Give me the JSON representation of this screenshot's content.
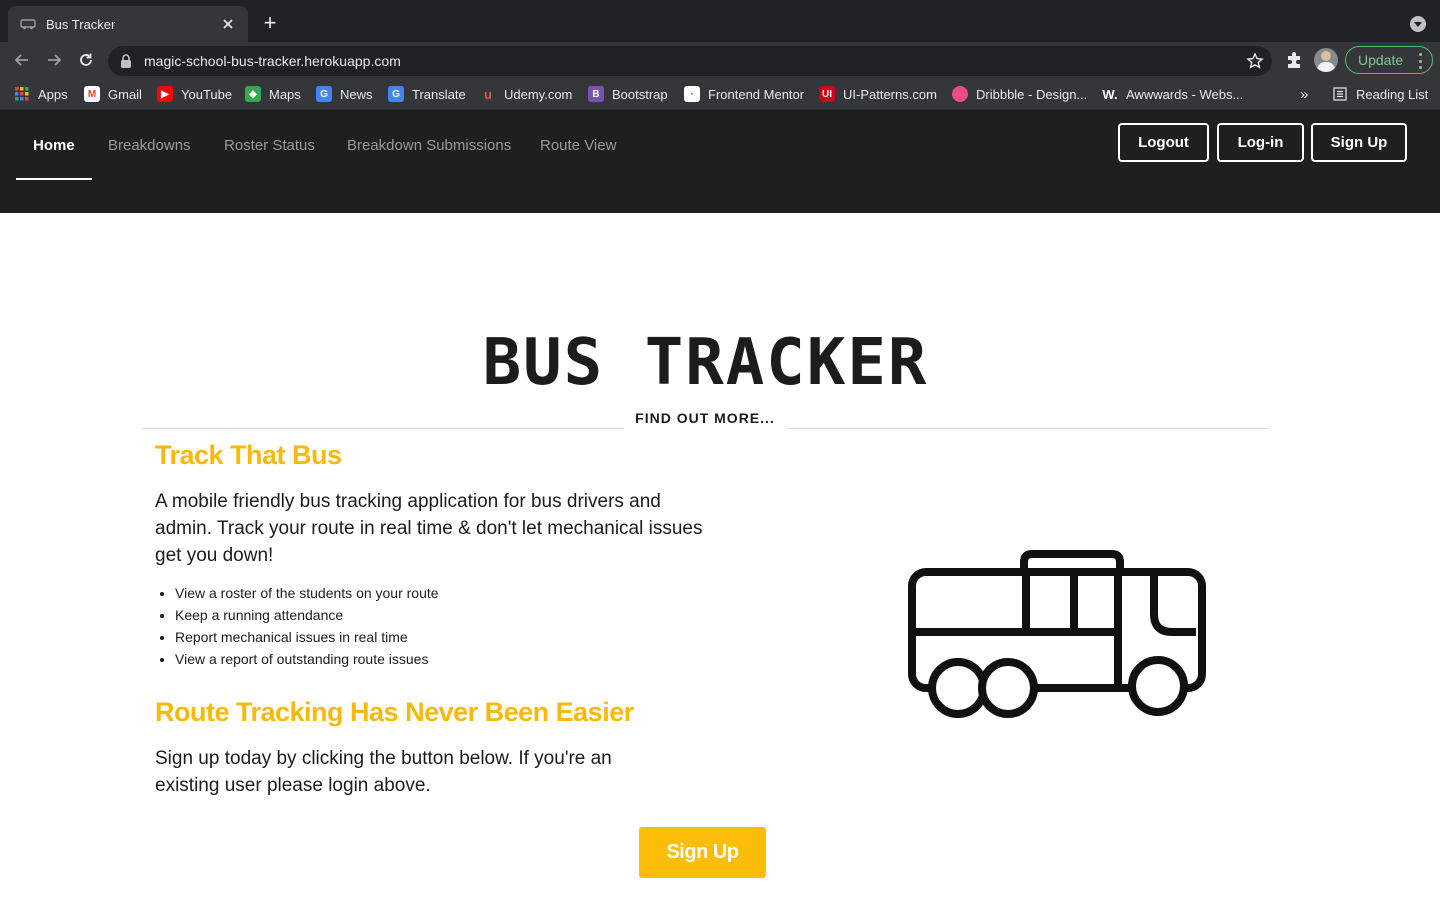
{
  "browser": {
    "tab_title": "Bus Tracker",
    "url": "magic-school-bus-tracker.herokuapp.com",
    "update_label": "Update",
    "bookmarks": [
      {
        "label": "Apps",
        "icon": "apps-grid-icon"
      },
      {
        "label": "Gmail",
        "icon": "gmail-icon"
      },
      {
        "label": "YouTube",
        "icon": "youtube-icon"
      },
      {
        "label": "Maps",
        "icon": "maps-icon"
      },
      {
        "label": "News",
        "icon": "news-icon"
      },
      {
        "label": "Translate",
        "icon": "translate-icon"
      },
      {
        "label": "Udemy.com",
        "icon": "udemy-icon"
      },
      {
        "label": "Bootstrap",
        "icon": "bootstrap-icon"
      },
      {
        "label": "Frontend Mentor",
        "icon": "frontend-mentor-icon"
      },
      {
        "label": "UI-Patterns.com",
        "icon": "ui-patterns-icon"
      },
      {
        "label": "Dribbble - Design...",
        "icon": "dribbble-icon"
      },
      {
        "label": "Awwwards - Webs...",
        "icon": "awwwards-icon"
      }
    ],
    "more_label": "»",
    "reading_list": "Reading List"
  },
  "nav": {
    "links": [
      "Home",
      "Breakdowns",
      "Roster Status",
      "Breakdown Submissions",
      "Route View"
    ],
    "auth": [
      "Logout",
      "Log-in",
      "Sign Up"
    ]
  },
  "hero": {
    "title": "BUS TRACKER",
    "find_more": "FIND OUT MORE..."
  },
  "section1": {
    "heading": "Track That Bus",
    "lead": "A mobile friendly bus tracking application for bus drivers and admin. Track your route in real time & don't let mechanical issues get you down!",
    "bullets": [
      "View a roster of the students on your route",
      "Keep a running attendance",
      "Report mechanical issues in real time",
      "View a report of outstanding route issues"
    ]
  },
  "section2": {
    "heading": "Route Tracking Has Never Been Easier",
    "lead": "Sign up today by clicking the button below. If you're an existing user please login above."
  },
  "cta": {
    "label": "Sign Up"
  },
  "colors": {
    "accent": "#fbbd07",
    "nav_bg": "#1f1f1f",
    "text": "#1c1c1c"
  }
}
